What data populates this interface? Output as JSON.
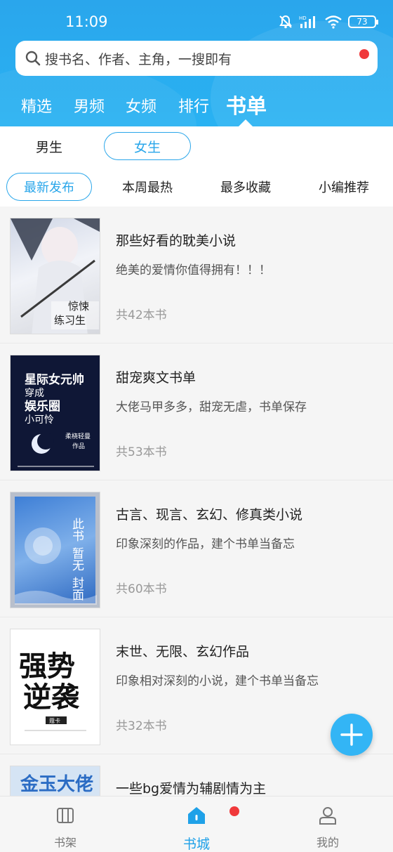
{
  "status_bar": {
    "time": "11:09",
    "battery": "73",
    "network_label": "HD"
  },
  "search": {
    "placeholder": "搜书名、作者、主角，一搜即有"
  },
  "top_tabs": [
    "精选",
    "男频",
    "女频",
    "排行",
    "书单"
  ],
  "active_top_tab": "书单",
  "gender_tabs": {
    "male": "男生",
    "female": "女生"
  },
  "sort_tabs": [
    "最新发布",
    "本周最热",
    "最多收藏",
    "小编推荐"
  ],
  "lists": [
    {
      "title": "那些好看的耽美小说",
      "desc": "绝美的爱情你值得拥有！！！",
      "count": "共42本书",
      "cover_text": [
        "惊悚",
        "练习生"
      ]
    },
    {
      "title": "甜宠爽文书单",
      "desc": "大佬马甲多多，甜宠无虐，书单保存",
      "count": "共53本书",
      "cover_text": [
        "星际女元帅",
        "穿成",
        "娱乐圈",
        "小可怜",
        "柔桡轻曼",
        "作品"
      ]
    },
    {
      "title": "古言、现言、玄幻、修真类小说",
      "desc": "印象深刻的作品，建个书单当备忘",
      "count": "共60本书",
      "cover_text": [
        "此书",
        "暂无",
        "封面"
      ]
    },
    {
      "title": "末世、无限、玄幻作品",
      "desc": "印象相对深刻的小说，建个书单当备忘",
      "count": "共32本书",
      "cover_text": [
        "强势",
        "逆袭",
        "蔻卡"
      ]
    },
    {
      "title": "一些bg爱情为辅剧情为主",
      "desc": "",
      "count": "",
      "cover_text": [
        "金玉大佬"
      ]
    }
  ],
  "bottom_nav": [
    {
      "label": "书架",
      "icon": "bookshelf-icon"
    },
    {
      "label": "书城",
      "icon": "home-icon"
    },
    {
      "label": "我的",
      "icon": "person-icon"
    }
  ],
  "colors": {
    "accent": "#29a6ea",
    "header": "#2aa6ec",
    "badge": "#f0393b"
  }
}
